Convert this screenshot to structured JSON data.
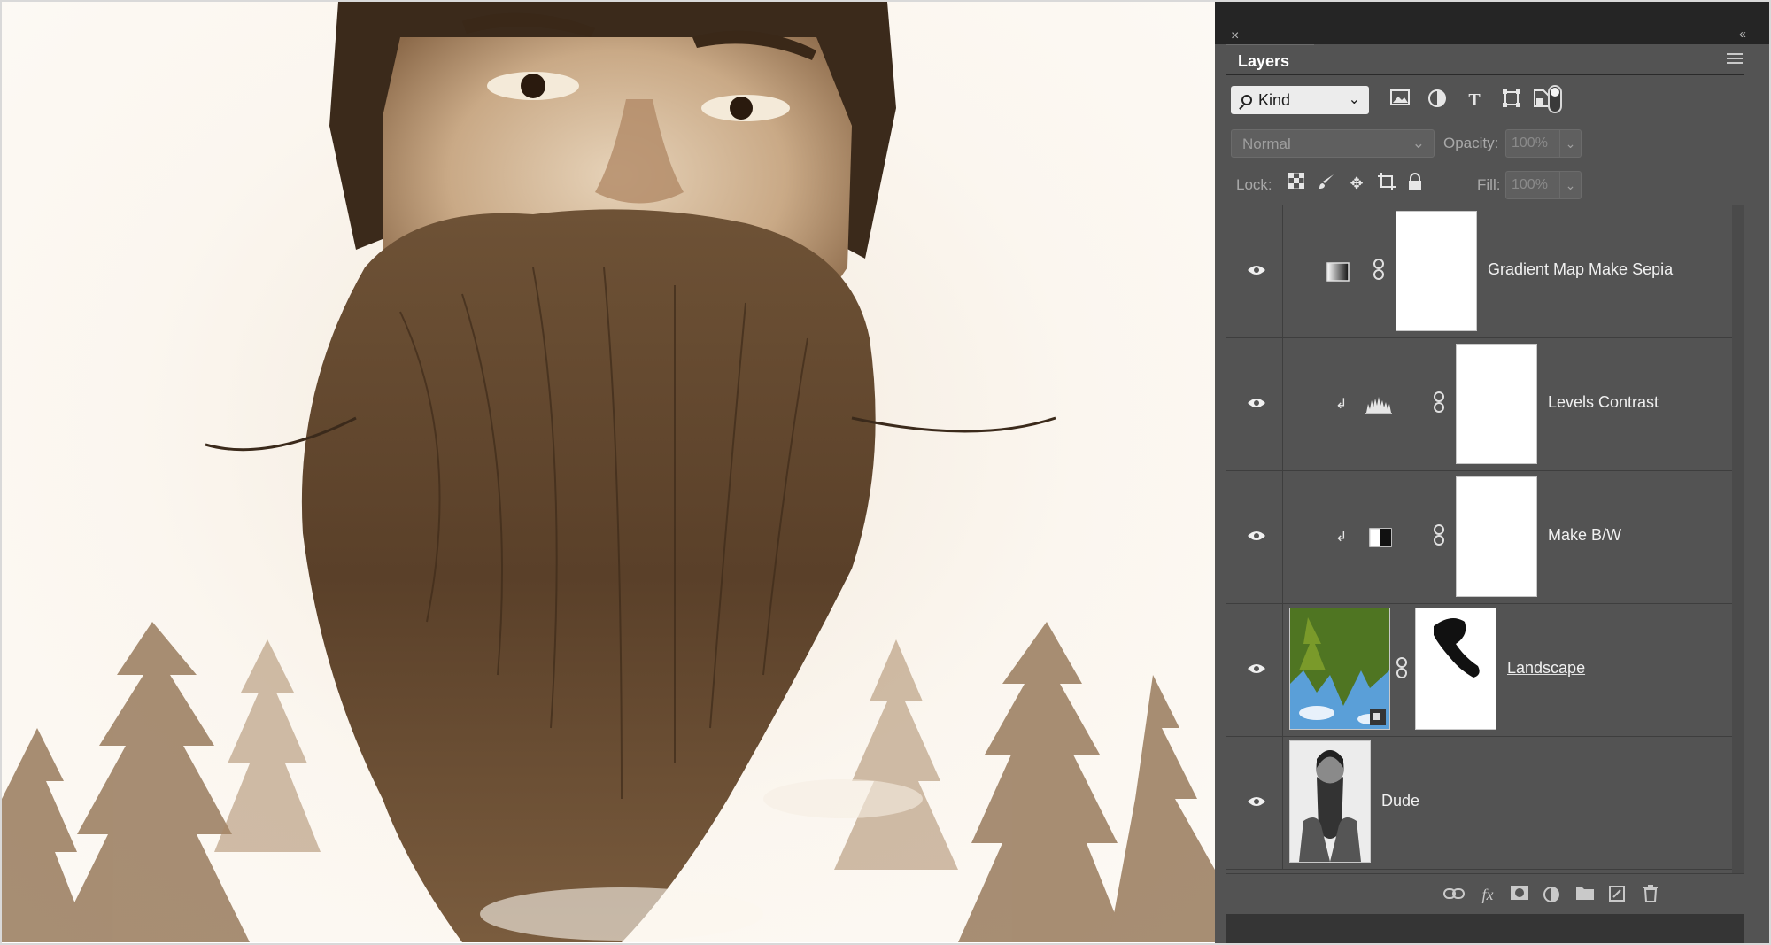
{
  "panel": {
    "close": "×",
    "collapse": "‹‹",
    "tab_title": "Layers"
  },
  "filter": {
    "kind_label": "Kind",
    "icons": [
      "image-filter-icon",
      "adjustment-filter-icon",
      "type-filter-icon",
      "shape-filter-icon",
      "smart-object-filter-icon"
    ]
  },
  "blend": {
    "mode": "Normal",
    "opacity_label": "Opacity:",
    "opacity_value": "100%",
    "lock_label": "Lock:",
    "fill_label": "Fill:",
    "fill_value": "100%"
  },
  "layers": [
    {
      "name": "Gradient Map Make Sepia",
      "visible": true,
      "type": "gradient-map-adjustment",
      "clipped": false
    },
    {
      "name": "Levels Contrast",
      "visible": true,
      "type": "levels-adjustment",
      "clipped": true
    },
    {
      "name": "Make B/W",
      "visible": true,
      "type": "black-white-adjustment",
      "clipped": true
    },
    {
      "name": "Landscape",
      "visible": true,
      "type": "smart-object-with-mask",
      "clipped": false
    },
    {
      "name": "Dude",
      "visible": true,
      "type": "pixel-layer",
      "clipped": false
    }
  ],
  "bottom_toolbar": [
    "link-layers-icon",
    "fx-icon",
    "add-mask-icon",
    "new-adjustment-icon",
    "new-group-icon",
    "new-layer-icon",
    "delete-icon"
  ],
  "colors": {
    "panel_bg": "#535353",
    "panel_dark": "#353535",
    "sepia_light": "#f3e9dc",
    "sepia_dark": "#5a3e22"
  }
}
